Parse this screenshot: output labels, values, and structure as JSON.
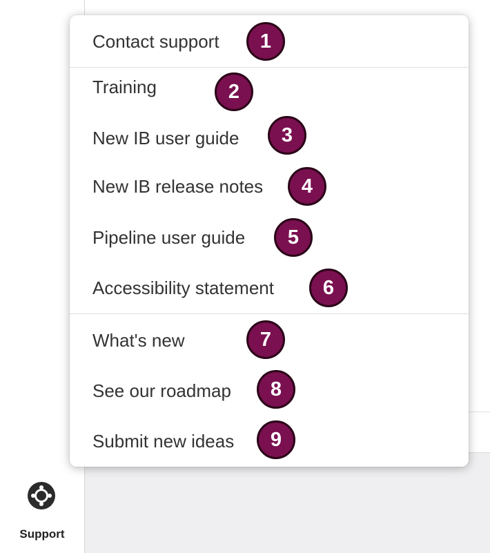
{
  "sidebar": {
    "support": {
      "label": "Support",
      "icon": "support-lifebuoy-icon"
    }
  },
  "menu": {
    "items": [
      {
        "label": "Contact support"
      },
      {
        "label": "Training"
      },
      {
        "label": "New IB user guide"
      },
      {
        "label": "New IB release notes"
      },
      {
        "label": "Pipeline user guide"
      },
      {
        "label": "Accessibility statement"
      },
      {
        "label": "What's new"
      },
      {
        "label": "See our roadmap"
      },
      {
        "label": "Submit new ideas"
      }
    ]
  },
  "callouts": [
    "1",
    "2",
    "3",
    "4",
    "5",
    "6",
    "7",
    "8",
    "9"
  ],
  "colors": {
    "callout_fill": "#7a1050",
    "callout_border": "#2a0418",
    "text": "#333333"
  }
}
